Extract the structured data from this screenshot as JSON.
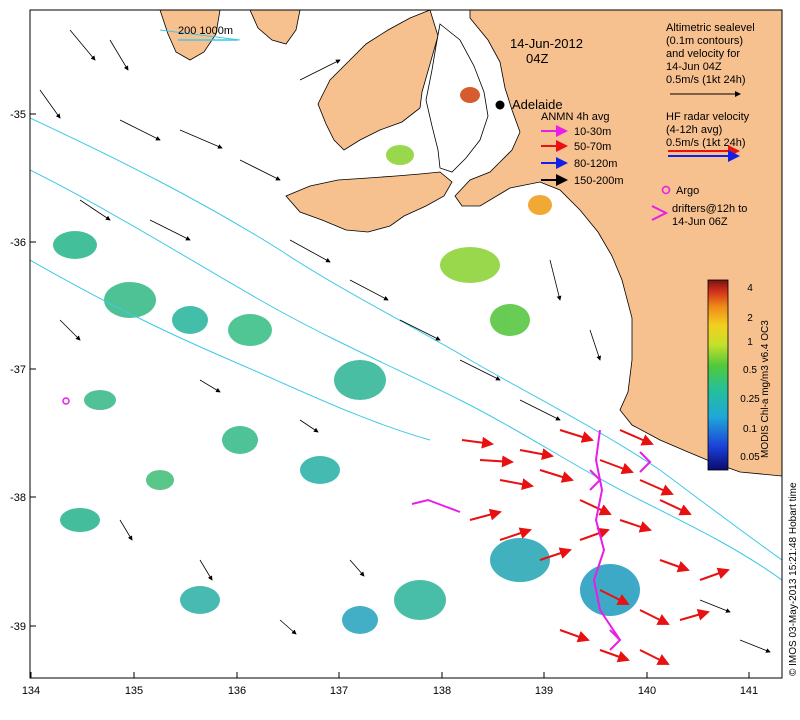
{
  "map": {
    "date_title": "14-Jun-2012",
    "time_title": "04Z",
    "city": "Adelaide",
    "bathy_label": "200  1000m",
    "credit": "© IMOS 03-May-2013 15:21:48 Hobart time",
    "colors": {
      "land": "#f6c08f",
      "ocean": "#ffffff",
      "contour": "#3ec9e8",
      "argo": "#e81de8",
      "radar_red": "#e81010",
      "radar_blue": "#1020e8"
    }
  },
  "axes": {
    "x_ticks": [
      "134",
      "135",
      "136",
      "137",
      "138",
      "139",
      "140",
      "141"
    ],
    "y_ticks": [
      "-35",
      "-36",
      "-37",
      "-38",
      "-39"
    ]
  },
  "legend": {
    "altimetric": [
      "Altimetric sealevel",
      "(0.1m contours)",
      "and velocity for",
      "14-Jun 04Z",
      "0.5m/s (1kt 24h)"
    ],
    "hf_radar": [
      "HF radar velocity",
      "(4-12h avg)",
      "0.5m/s (1kt 24h)"
    ],
    "anmn_title": "ANMN 4h avg",
    "anmn": [
      {
        "label": "10-30m",
        "color": "#e81de8"
      },
      {
        "label": "50-70m",
        "color": "#e81010"
      },
      {
        "label": "80-120m",
        "color": "#1020e8"
      },
      {
        "label": "150-200m",
        "color": "#000000"
      }
    ],
    "argo": "Argo",
    "drifters": [
      "drifters@12h to",
      "14-Jun 06Z"
    ]
  },
  "colorbar": {
    "title": "MODIS Chl-a mg/m3  v6.4 OC3",
    "ticks": [
      "4",
      "2",
      "1",
      "0.5",
      "0.25",
      "0.1",
      "0.05"
    ]
  }
}
